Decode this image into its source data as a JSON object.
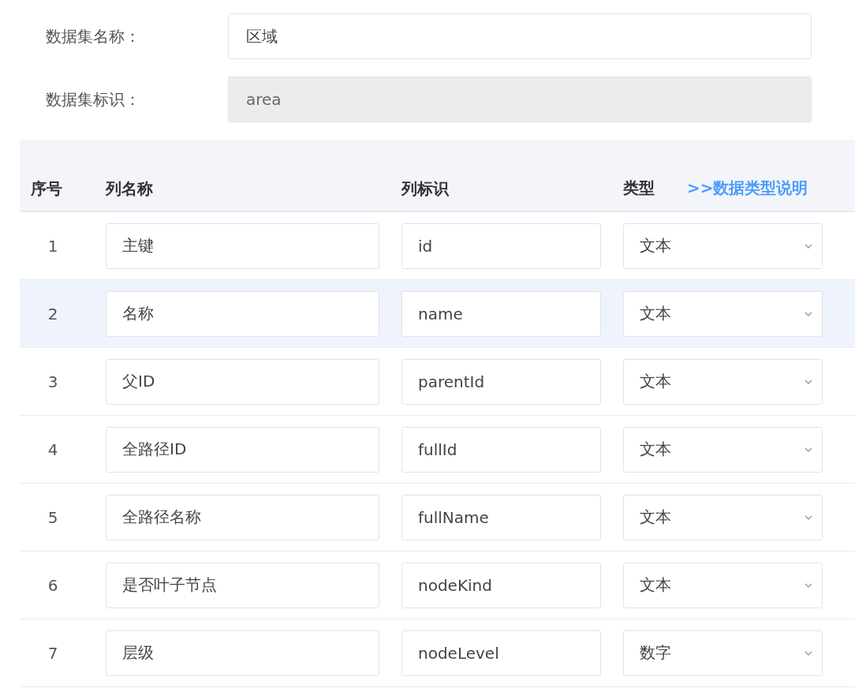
{
  "form": [
    {
      "label": "数据集名称：",
      "value": "区域",
      "disabled": false
    },
    {
      "label": "数据集标识：",
      "value": "area",
      "disabled": true
    }
  ],
  "table": {
    "columns": [
      "序号",
      "列名称",
      "列标识",
      "类型"
    ],
    "type_help_link": ">>数据类型说明",
    "rows": [
      {
        "index": "1",
        "name": "主键",
        "key": "id",
        "type": "文本",
        "selected": false
      },
      {
        "index": "2",
        "name": "名称",
        "key": "name",
        "type": "文本",
        "selected": true
      },
      {
        "index": "3",
        "name": "父ID",
        "key": "parentId",
        "type": "文本",
        "selected": false
      },
      {
        "index": "4",
        "name": "全路径ID",
        "key": "fullId",
        "type": "文本",
        "selected": false
      },
      {
        "index": "5",
        "name": "全路径名称",
        "key": "fullName",
        "type": "文本",
        "selected": false
      },
      {
        "index": "6",
        "name": "是否叶子节点",
        "key": "nodeKind",
        "type": "文本",
        "selected": false
      },
      {
        "index": "7",
        "name": "层级",
        "key": "nodeLevel",
        "type": "数字",
        "selected": false
      }
    ]
  }
}
